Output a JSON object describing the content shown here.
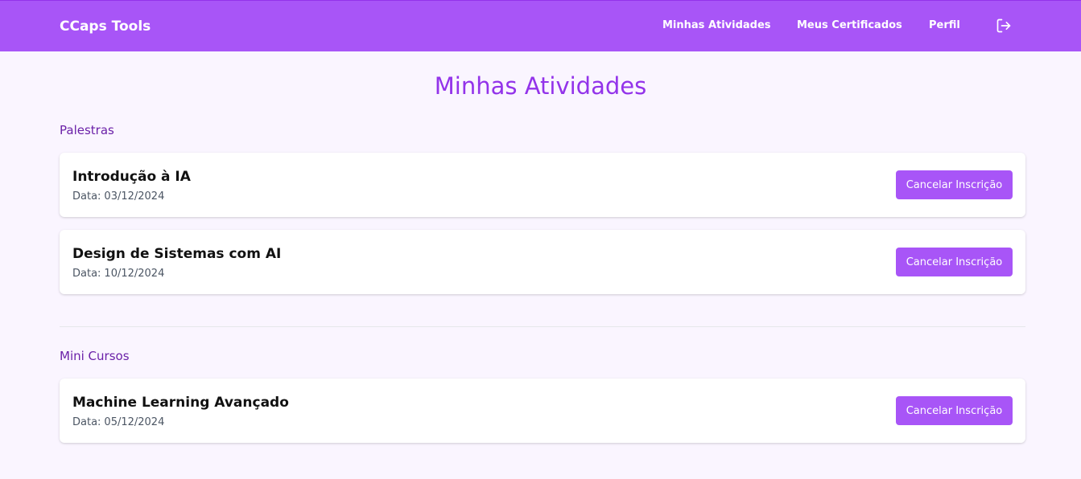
{
  "header": {
    "brand": "CCaps Tools",
    "nav": [
      "Minhas Atividades",
      "Meus Certificados",
      "Perfil"
    ],
    "logout_icon": "logout-icon"
  },
  "page": {
    "title": "Minhas Atividades"
  },
  "sections": [
    {
      "title": "Palestras",
      "items": [
        {
          "title": "Introdução à IA",
          "date_label": "Data:",
          "date": "03/12/2024",
          "action": "Cancelar Inscrição"
        },
        {
          "title": "Design de Sistemas com AI",
          "date_label": "Data:",
          "date": "10/12/2024",
          "action": "Cancelar Inscrição"
        }
      ]
    },
    {
      "title": "Mini Cursos",
      "items": [
        {
          "title": "Machine Learning Avançado",
          "date_label": "Data:",
          "date": "05/12/2024",
          "action": "Cancelar Inscrição"
        }
      ]
    }
  ],
  "colors": {
    "primary": "#a855f7",
    "title": "#9333ea",
    "section": "#6b21a8",
    "background": "#faf5ff"
  }
}
